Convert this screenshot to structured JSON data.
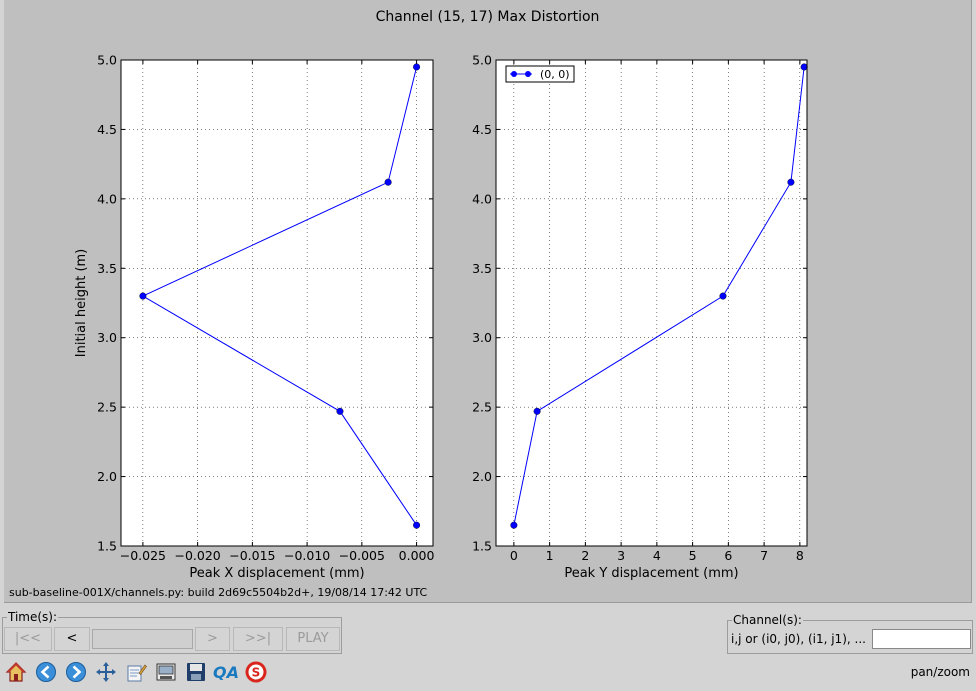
{
  "figure": {
    "suptitle": "Channel (15, 17) Max Distortion",
    "build_note": "sub-baseline-001X/channels.py: build 2d69c5504b2d+, 19/08/14 17:42 UTC"
  },
  "chart_data": [
    {
      "type": "line",
      "title": "",
      "xlabel": "Peak X displacement (mm)",
      "ylabel": "Initial height (m)",
      "xlim": [
        -0.027,
        0.0015
      ],
      "ylim": [
        1.5,
        5.0
      ],
      "xticks": [
        "−0.025",
        "−0.020",
        "−0.015",
        "−0.010",
        "−0.005",
        "0.000"
      ],
      "xtick_values": [
        -0.025,
        -0.02,
        -0.015,
        -0.01,
        -0.005,
        0.0
      ],
      "yticks": [
        "1.5",
        "2.0",
        "2.5",
        "3.0",
        "3.5",
        "4.0",
        "4.5",
        "5.0"
      ],
      "ytick_values": [
        1.5,
        2.0,
        2.5,
        3.0,
        3.5,
        4.0,
        4.5,
        5.0
      ],
      "grid": true,
      "series": [
        {
          "color": "#0000ff",
          "marker": "circle",
          "points": [
            [
              0.0,
              1.65
            ],
            [
              -0.007,
              2.47
            ],
            [
              -0.025,
              3.3
            ],
            [
              -0.0026,
              4.12
            ],
            [
              0.0,
              4.95
            ]
          ]
        }
      ]
    },
    {
      "type": "line",
      "title": "",
      "xlabel": "Peak Y displacement (mm)",
      "ylabel": "",
      "xlim": [
        -0.5,
        8.2
      ],
      "ylim": [
        1.5,
        5.0
      ],
      "xticks": [
        "0",
        "1",
        "2",
        "3",
        "4",
        "5",
        "6",
        "7",
        "8"
      ],
      "xtick_values": [
        0,
        1,
        2,
        3,
        4,
        5,
        6,
        7,
        8
      ],
      "yticks": [
        "1.5",
        "2.0",
        "2.5",
        "3.0",
        "3.5",
        "4.0",
        "4.5",
        "5.0"
      ],
      "ytick_values": [
        1.5,
        2.0,
        2.5,
        3.0,
        3.5,
        4.0,
        4.5,
        5.0
      ],
      "grid": true,
      "legend": {
        "position": "upper-left",
        "entries": [
          "(0, 0)"
        ]
      },
      "series": [
        {
          "name": "(0, 0)",
          "color": "#0000ff",
          "marker": "circle",
          "points": [
            [
              0.0,
              1.65
            ],
            [
              0.65,
              2.47
            ],
            [
              5.85,
              3.3
            ],
            [
              7.75,
              4.12
            ],
            [
              8.12,
              4.95
            ]
          ]
        }
      ]
    }
  ],
  "time_panel": {
    "title": "Time(s):",
    "first": "|<<",
    "prev": "<",
    "next": ">",
    "last": ">>|",
    "play": "PLAY"
  },
  "channel_panel": {
    "title": "Channel(s):",
    "hint": "i,j or (i0, j0), (i1, j1), ...",
    "value": ""
  },
  "toolbar": {
    "tools": [
      "home-icon",
      "back-arrow-icon",
      "forward-arrow-icon",
      "pan-move-icon",
      "edit-icon",
      "print-icon",
      "save-disk-icon",
      "qa-icon",
      "s-badge-icon"
    ],
    "qa_label": "QA",
    "s_label": "S",
    "mode": "pan/zoom"
  }
}
